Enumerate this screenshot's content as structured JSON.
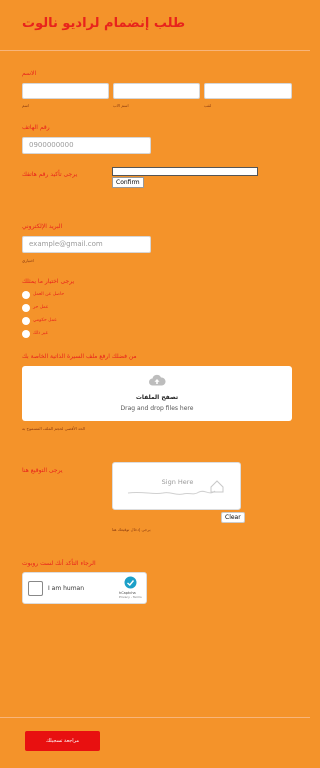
{
  "header": {
    "title": "طلب إنضمام لراديو نالوت"
  },
  "name_field": {
    "label": "الاسم",
    "sublabels": [
      "اسم",
      "اسم الاب",
      "لقب"
    ]
  },
  "phone": {
    "label": "رقم الهاتف",
    "placeholder": "0900000000"
  },
  "confirm_phone": {
    "label": "يرجى تأكيد رقم هاتفك",
    "button": "Confirm"
  },
  "email": {
    "label": "البريد الإلكتروني",
    "placeholder": "example@gmail.com",
    "sublabel": "اختياري"
  },
  "status": {
    "label": "يرجى اختيار ما يمثلك",
    "options": [
      "حاصل عن العمل",
      "عمل حر",
      "عمل حكومي",
      "غير ذلك"
    ]
  },
  "upload": {
    "label": "من فضلك ارفع ملف السيرة الذاتية الخاصة بك",
    "browse": "تصفح الملفات",
    "hint": "Drag and drop files here",
    "sublabel": "الحد الأقصى لحجم الملف المسموح به"
  },
  "signature": {
    "label": "يرجى التوقيع هنا",
    "placeholder": "Sign Here",
    "clear": "Clear",
    "sublabel": "يرجى إدخال توقيعك هنا"
  },
  "captcha": {
    "label": "الرجاء التأكد أنك لست روبوت",
    "text": "I am human",
    "brand": "hCaptcha",
    "links": "Privacy - Terms"
  },
  "submit": {
    "label": "مراجعة تسجيلك"
  },
  "colors": {
    "background": "#f4932a",
    "accent": "#e8231c",
    "submit": "#e81010"
  }
}
